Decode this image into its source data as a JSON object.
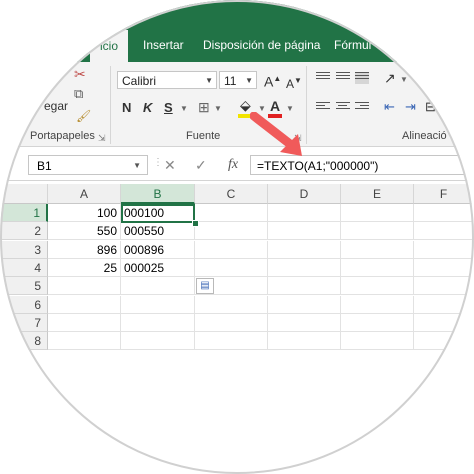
{
  "ribbon": {
    "tabs": [
      {
        "label": "icio"
      },
      {
        "label": "Insertar"
      },
      {
        "label": "Disposición de página"
      },
      {
        "label": "Fórmul"
      }
    ],
    "clipboard": {
      "paste_label": "egar",
      "group_label": "Portapapeles"
    },
    "font": {
      "font_name": "Calibri",
      "font_size": "11",
      "bold": "N",
      "italic": "K",
      "underline": "S",
      "grow": "A",
      "shrink": "A",
      "font_color": "A",
      "group_label": "Fuente"
    },
    "alignment": {
      "group_label": "Alineació"
    }
  },
  "formula_bar": {
    "name_box": "B1",
    "cancel": "✕",
    "enter": "✓",
    "fx": "fx",
    "formula": "=TEXTO(A1;\"000000\")"
  },
  "grid": {
    "columns": [
      "A",
      "B",
      "C",
      "D",
      "E",
      "F"
    ],
    "rows": [
      {
        "num": "1",
        "a": "100",
        "b": "000100"
      },
      {
        "num": "2",
        "a": "550",
        "b": "000550"
      },
      {
        "num": "3",
        "a": "896",
        "b": "000896"
      },
      {
        "num": "4",
        "a": "25",
        "b": "000025"
      },
      {
        "num": "5",
        "a": "",
        "b": ""
      },
      {
        "num": "6",
        "a": "",
        "b": ""
      },
      {
        "num": "7",
        "a": "",
        "b": ""
      },
      {
        "num": "8",
        "a": "",
        "b": ""
      }
    ],
    "selected_cell": "B1"
  },
  "colors": {
    "accent": "#217346",
    "arrow": "#f05a5a"
  }
}
